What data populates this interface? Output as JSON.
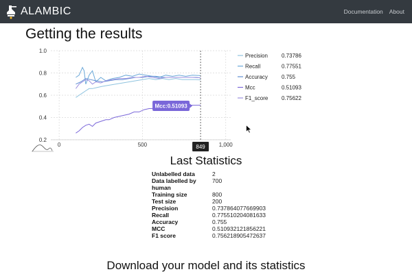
{
  "navbar": {
    "brand": "ALAMBIC",
    "links": [
      "Documentation",
      "About"
    ]
  },
  "page": {
    "title": "Getting the results"
  },
  "chart_data": {
    "type": "line",
    "x_ticks": [
      "0",
      "500",
      "1,000"
    ],
    "y_ticks": [
      "0.2",
      "0.4",
      "0.6",
      "0.8",
      "1.0"
    ],
    "xlim": [
      -50,
      1030
    ],
    "ylim": [
      0.2,
      1.0
    ],
    "grid": true,
    "hover_x": 849,
    "hover_x_label": "849",
    "tooltip": {
      "series": "Mcc",
      "value": "0.51093",
      "label": "Mcc:0.51093",
      "color": "#7a67d9"
    },
    "legend_position": "right",
    "series": [
      {
        "name": "Precision",
        "value_label": "0.73786",
        "color": "#8ec3df",
        "x": [
          100,
          120,
          140,
          160,
          180,
          200,
          230,
          260,
          300,
          340,
          380,
          420,
          460,
          500,
          540,
          580,
          620,
          660,
          700,
          740,
          780,
          820,
          849
        ],
        "y": [
          0.58,
          0.6,
          0.62,
          0.64,
          0.66,
          0.66,
          0.67,
          0.68,
          0.69,
          0.7,
          0.71,
          0.72,
          0.73,
          0.74,
          0.75,
          0.74,
          0.75,
          0.74,
          0.75,
          0.74,
          0.74,
          0.74,
          0.738
        ]
      },
      {
        "name": "Recall",
        "value_label": "0.77551",
        "color": "#6aa8d8",
        "x": [
          100,
          120,
          140,
          150,
          160,
          180,
          200,
          220,
          250,
          280,
          320,
          360,
          400,
          440,
          480,
          520,
          560,
          600,
          640,
          680,
          720,
          760,
          800,
          849
        ],
        "y": [
          0.76,
          0.78,
          0.85,
          0.82,
          0.7,
          0.78,
          0.82,
          0.72,
          0.76,
          0.73,
          0.75,
          0.76,
          0.78,
          0.77,
          0.79,
          0.78,
          0.77,
          0.76,
          0.78,
          0.77,
          0.78,
          0.77,
          0.78,
          0.776
        ]
      },
      {
        "name": "Accuracy",
        "value_label": "0.755",
        "color": "#5f8fd3",
        "x": [
          100,
          130,
          160,
          190,
          220,
          260,
          300,
          340,
          380,
          420,
          460,
          500,
          540,
          580,
          620,
          660,
          700,
          740,
          780,
          820,
          849
        ],
        "y": [
          0.7,
          0.72,
          0.75,
          0.74,
          0.73,
          0.72,
          0.73,
          0.74,
          0.74,
          0.75,
          0.76,
          0.76,
          0.77,
          0.77,
          0.76,
          0.76,
          0.76,
          0.76,
          0.76,
          0.76,
          0.755
        ]
      },
      {
        "name": "Mcc",
        "value_label": "0.51093",
        "color": "#7a67d9",
        "x": [
          100,
          120,
          140,
          160,
          180,
          200,
          220,
          240,
          260,
          280,
          300,
          330,
          360,
          390,
          420,
          450,
          480,
          510,
          540,
          570,
          600,
          630,
          660,
          700,
          740,
          780,
          820,
          849
        ],
        "y": [
          0.26,
          0.28,
          0.31,
          0.33,
          0.34,
          0.32,
          0.35,
          0.36,
          0.37,
          0.38,
          0.38,
          0.4,
          0.41,
          0.42,
          0.43,
          0.45,
          0.45,
          0.47,
          0.48,
          0.48,
          0.49,
          0.5,
          0.5,
          0.51,
          0.51,
          0.51,
          0.51,
          0.511
        ]
      },
      {
        "name": "F1_score",
        "value_label": "0.75622",
        "color": "#9b8fe0",
        "x": [
          100,
          120,
          140,
          160,
          180,
          200,
          220,
          250,
          280,
          320,
          360,
          400,
          440,
          480,
          520,
          560,
          600,
          640,
          680,
          720,
          760,
          800,
          849
        ],
        "y": [
          0.66,
          0.7,
          0.72,
          0.74,
          0.73,
          0.7,
          0.72,
          0.71,
          0.73,
          0.74,
          0.75,
          0.75,
          0.76,
          0.76,
          0.77,
          0.76,
          0.75,
          0.76,
          0.76,
          0.76,
          0.76,
          0.76,
          0.756
        ]
      }
    ]
  },
  "stats": {
    "title": "Last Statistics",
    "rows": [
      {
        "label": "Unlabelled data",
        "value": "2"
      },
      {
        "label": "Data labelled by human",
        "value": "700"
      },
      {
        "label": "Training size",
        "value": "800"
      },
      {
        "label": "Test size",
        "value": "200"
      },
      {
        "label": "Precision",
        "value": "0.737864077669903"
      },
      {
        "label": "Recall",
        "value": "0.775510204081633"
      },
      {
        "label": "Accuracy",
        "value": "0.755"
      },
      {
        "label": "MCC",
        "value": "0.510932121856221"
      },
      {
        "label": "F1 score",
        "value": "0.756218905472637"
      }
    ]
  },
  "download": {
    "title": "Download your model and its statistics"
  }
}
